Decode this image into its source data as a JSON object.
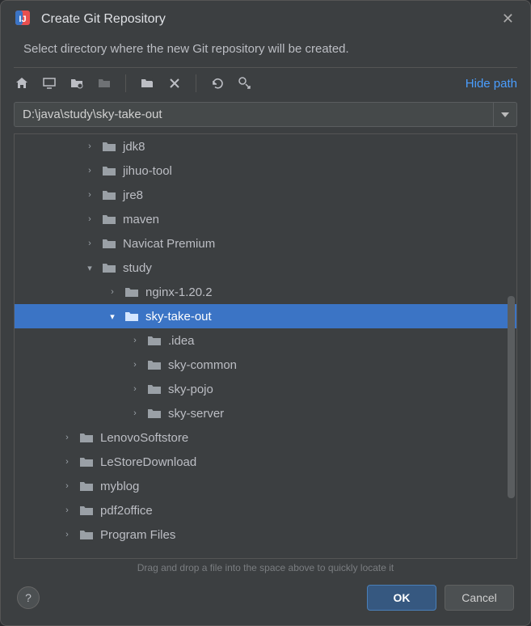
{
  "title": "Create Git Repository",
  "subtitle": "Select directory where the new Git repository will be created.",
  "hidePathLabel": "Hide path",
  "pathValue": "D:\\java\\study\\sky-take-out",
  "hint": "Drag and drop a file into the space above to quickly locate it",
  "buttons": {
    "ok": "OK",
    "cancel": "Cancel"
  },
  "tree": [
    {
      "depth": 2,
      "expand": "right",
      "label": "jdk8",
      "selected": false
    },
    {
      "depth": 2,
      "expand": "right",
      "label": "jihuo-tool",
      "selected": false
    },
    {
      "depth": 2,
      "expand": "right",
      "label": "jre8",
      "selected": false
    },
    {
      "depth": 2,
      "expand": "right",
      "label": "maven",
      "selected": false
    },
    {
      "depth": 2,
      "expand": "right",
      "label": "Navicat Premium",
      "selected": false
    },
    {
      "depth": 2,
      "expand": "down",
      "label": "study",
      "selected": false
    },
    {
      "depth": 3,
      "expand": "right",
      "label": "nginx-1.20.2",
      "selected": false
    },
    {
      "depth": 3,
      "expand": "down",
      "label": "sky-take-out",
      "selected": true
    },
    {
      "depth": 4,
      "expand": "right",
      "label": ".idea",
      "selected": false
    },
    {
      "depth": 4,
      "expand": "right",
      "label": "sky-common",
      "selected": false
    },
    {
      "depth": 4,
      "expand": "right",
      "label": "sky-pojo",
      "selected": false
    },
    {
      "depth": 4,
      "expand": "right",
      "label": "sky-server",
      "selected": false
    },
    {
      "depth": 1,
      "expand": "right",
      "label": "LenovoSoftstore",
      "selected": false
    },
    {
      "depth": 1,
      "expand": "right",
      "label": "LeStoreDownload",
      "selected": false
    },
    {
      "depth": 1,
      "expand": "right",
      "label": "myblog",
      "selected": false
    },
    {
      "depth": 1,
      "expand": "right",
      "label": "pdf2office",
      "selected": false
    },
    {
      "depth": 1,
      "expand": "right",
      "label": "Program Files",
      "selected": false
    }
  ]
}
